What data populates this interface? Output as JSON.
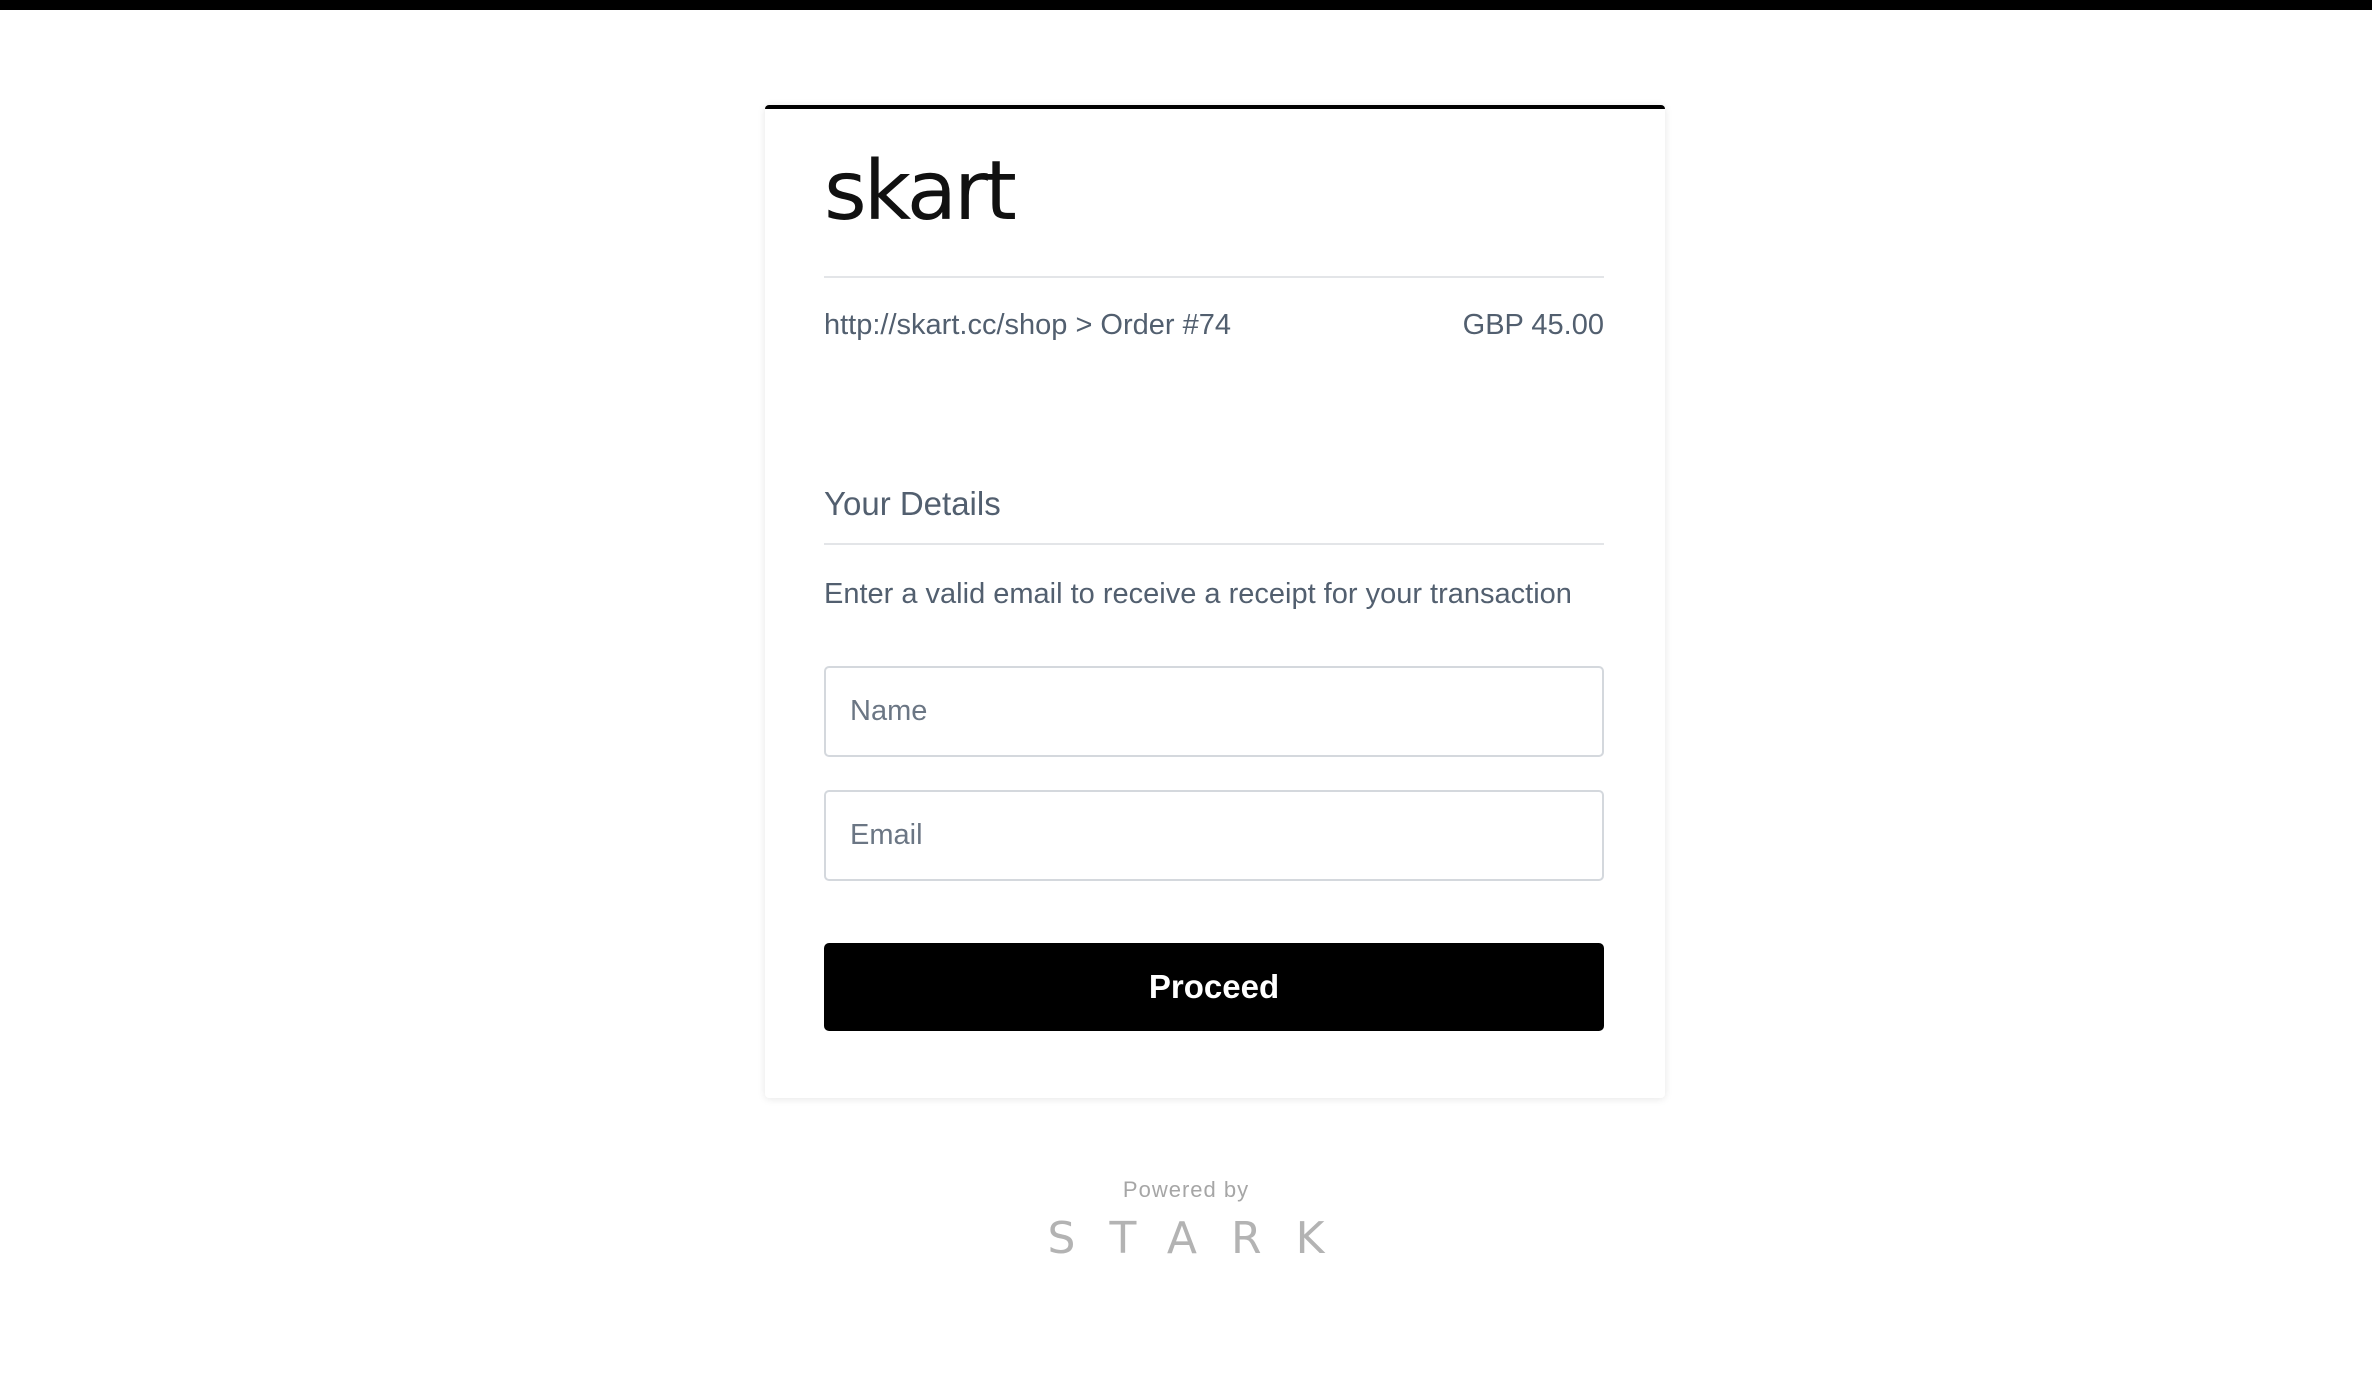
{
  "brand": {
    "logo_text": "skart"
  },
  "order": {
    "path": "http://skart.cc/shop > Order #74",
    "amount": "GBP 45.00"
  },
  "details": {
    "title": "Your Details",
    "helper_text": "Enter a valid email to receive a receipt for your transaction",
    "name_placeholder": "Name",
    "name_value": "",
    "email_placeholder": "Email",
    "email_value": ""
  },
  "actions": {
    "proceed_label": "Proceed"
  },
  "footer": {
    "powered_by": "Powered by",
    "provider_logo": "STARK"
  },
  "colors": {
    "accent": "#000000",
    "text": "#525f6f",
    "border": "#d4d8dd",
    "footer": "#b3b3b3"
  }
}
